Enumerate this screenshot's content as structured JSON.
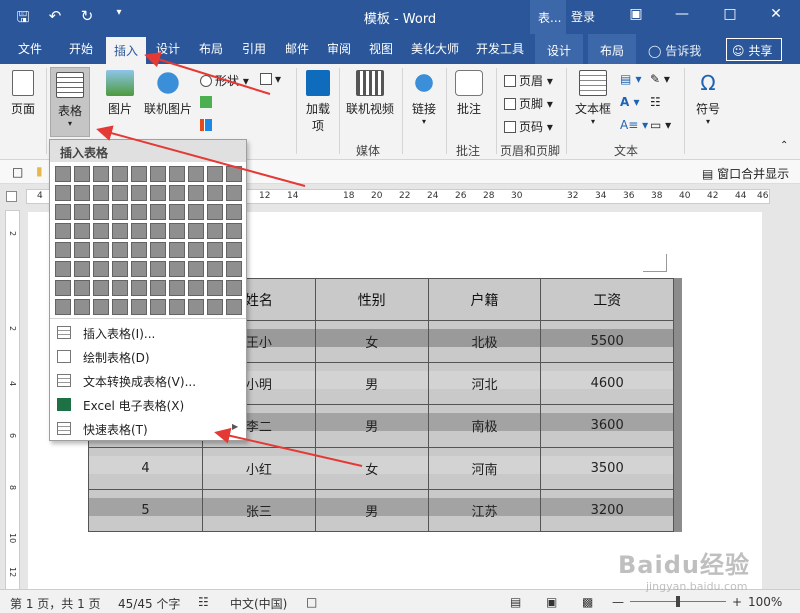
{
  "title_bar": {
    "doc_title": "模板 - Word",
    "contextual_tab_group": "表...",
    "login": "登录"
  },
  "tabs": [
    "文件",
    "开始",
    "插入",
    "设计",
    "布局",
    "引用",
    "邮件",
    "审阅",
    "视图",
    "美化大师",
    "开发工具",
    "设计",
    "布局"
  ],
  "active_tab": "插入",
  "tell_me": "告诉我",
  "share": "共享",
  "ribbon": {
    "page_label": "页面",
    "table_label": "表格",
    "picture_label": "图片",
    "online_picture_label": "联机图片",
    "shapes_label": "形状",
    "addins_label": "加载\n项",
    "online_video_label": "联机视频",
    "media_group": "媒体",
    "link_label": "链接",
    "comment_label": "批注",
    "comment_group": "批注",
    "header_label": "页眉",
    "footer_label": "页脚",
    "page_number_label": "页码",
    "header_footer_group": "页眉和页脚",
    "textbox_label": "文本框",
    "text_group": "文本",
    "symbol_label": "符号",
    "symbol_char": "Ω"
  },
  "window_merge": "窗口合并显示",
  "ruler": [
    "4",
    "12",
    "14",
    "18",
    "20",
    "22",
    "24",
    "26",
    "28",
    "30",
    "32",
    "34",
    "36",
    "38",
    "40",
    "42",
    "44",
    "46"
  ],
  "vruler": [
    "2",
    "2",
    "4",
    "6",
    "8",
    "10",
    "12"
  ],
  "dropdown": {
    "header": "插入表格",
    "items": [
      {
        "label": "插入表格(I)..."
      },
      {
        "label": "绘制表格(D)"
      },
      {
        "label": "文本转换成表格(V)..."
      },
      {
        "label": "Excel 电子表格(X)"
      },
      {
        "label": "快速表格(T)"
      }
    ]
  },
  "table": {
    "headers": [
      "姓名",
      "性别",
      "户籍",
      "工资"
    ],
    "rows": [
      [
        "",
        "王小",
        "女",
        "北极",
        "5500"
      ],
      [
        "",
        "小明",
        "男",
        "河北",
        "4600"
      ],
      [
        "",
        "李二",
        "男",
        "南极",
        "3600"
      ],
      [
        "4",
        "小红",
        "女",
        "河南",
        "3500"
      ],
      [
        "5",
        "张三",
        "男",
        "江苏",
        "3200"
      ]
    ]
  },
  "status": {
    "page": "第 1 页，共 1 页",
    "words": "45/45 个字",
    "language": "中文(中国)",
    "zoom": "100%"
  },
  "watermark": {
    "text": "Baidu经验",
    "url": "jingyan.baidu.com"
  },
  "colors": {
    "accent": "#2b579a",
    "arrow": "#e53935"
  }
}
